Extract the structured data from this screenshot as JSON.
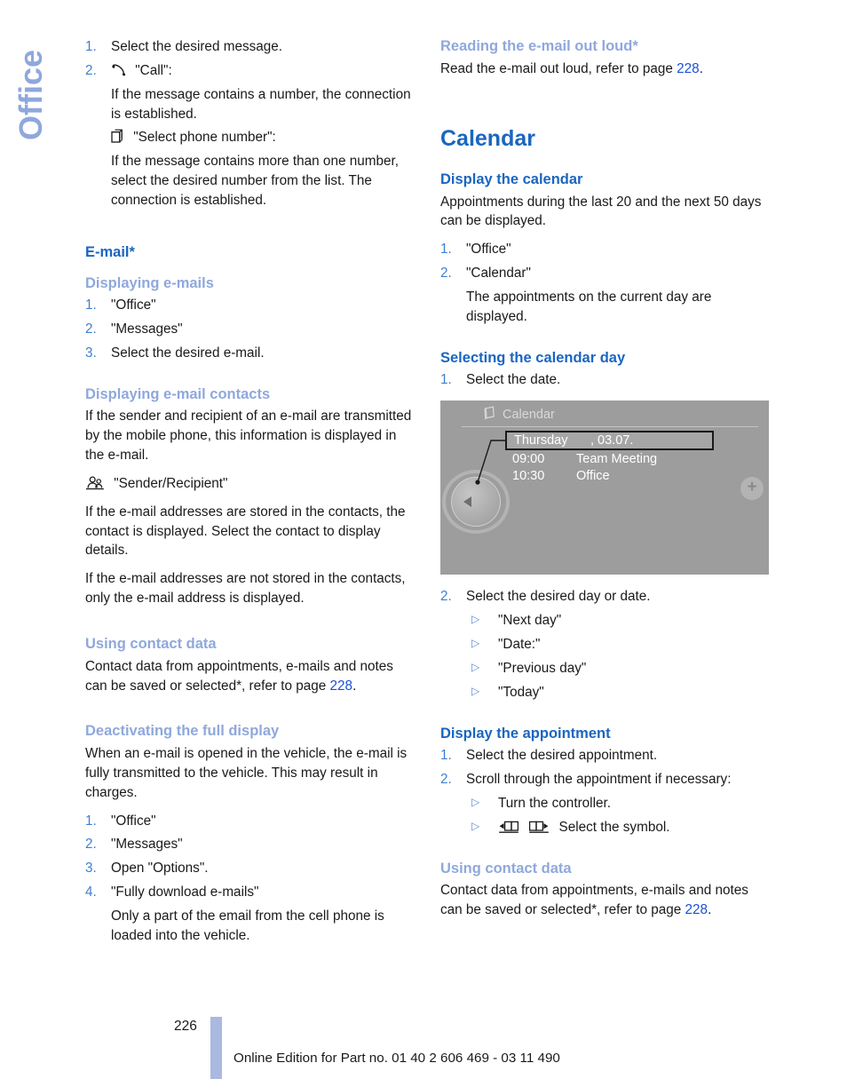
{
  "side_tab": {
    "label": "Office"
  },
  "left_column": {
    "top_steps": [
      {
        "num": "1.",
        "text": "Select the desired message."
      },
      {
        "num": "2.",
        "icon": "phone-handset-icon",
        "text": "\"Call\":"
      }
    ],
    "call_note": "If the message contains a number, the connection is established.",
    "select_number_icon": "stacked-pages-icon",
    "select_number_label": "\"Select phone number\":",
    "select_number_note": "If the message contains more than one number, select the desired number from the list. The connection is established.",
    "email_heading": "E-mail*",
    "displaying_emails_heading": "Displaying e-mails",
    "displaying_emails_steps": [
      {
        "num": "1.",
        "text": "\"Office\""
      },
      {
        "num": "2.",
        "text": "\"Messages\""
      },
      {
        "num": "3.",
        "text": "Select the desired e-mail."
      }
    ],
    "contacts_heading": "Displaying e-mail contacts",
    "contacts_para1": "If the sender and recipient of an e-mail are transmitted by the mobile phone, this information is displayed in the e-mail.",
    "sender_recipient_icon": "contacts-people-icon",
    "sender_recipient_label": "\"Sender/Recipient\"",
    "contacts_para2": "If the e-mail addresses are stored in the contacts, the contact is displayed. Select the contact to display details.",
    "contacts_para3": "If the e-mail addresses are not stored in the contacts, only the e-mail address is displayed.",
    "using_contact_heading": "Using contact data",
    "using_contact_text_pre": "Contact data from appointments, e-mails and notes can be saved or selected*, refer to page ",
    "using_contact_pageref": "228",
    "using_contact_text_post": ".",
    "deactivating_heading": "Deactivating the full display",
    "deactivating_para": "When an e-mail is opened in the vehicle, the e-mail is fully transmitted to the vehicle. This may result in charges.",
    "deactivating_steps": [
      {
        "num": "1.",
        "text": "\"Office\""
      },
      {
        "num": "2.",
        "text": "\"Messages\""
      },
      {
        "num": "3.",
        "text": "Open \"Options\"."
      },
      {
        "num": "4.",
        "text": "\"Fully download e-mails\""
      }
    ],
    "deactivating_step4_note": "Only a part of the email from the cell phone is loaded into the vehicle."
  },
  "right_column": {
    "reading_heading": "Reading the e-mail out loud*",
    "reading_text_pre": "Read the e-mail out loud, refer to page ",
    "reading_pageref": "228",
    "reading_text_post": ".",
    "calendar_heading": "Calendar",
    "display_calendar_heading": "Display the calendar",
    "display_calendar_para": "Appointments during the last 20 and the next 50 days can be displayed.",
    "display_calendar_steps": [
      {
        "num": "1.",
        "text": "\"Office\""
      },
      {
        "num": "2.",
        "text": "\"Calendar\""
      }
    ],
    "display_calendar_step2_note": "The appointments on the current day are displayed.",
    "selecting_day_heading": "Selecting the calendar day",
    "selecting_day_step1": {
      "num": "1.",
      "text": "Select the date."
    },
    "figure": {
      "screen_icon": "calendar-page-icon",
      "screen_title": "Calendar",
      "selected_day": "Thursday",
      "selected_date": ", 03.07.",
      "appointments": [
        {
          "time": "09:00",
          "title": "Team Meeting"
        },
        {
          "time": "10:30",
          "title": "Office"
        }
      ],
      "plus_label": "+",
      "controller_icon": "controller-knob-icon"
    },
    "selecting_day_step2": {
      "num": "2.",
      "text": "Select the desired day or date."
    },
    "selecting_day_options": [
      "\"Next day\"",
      "\"Date:\"",
      "\"Previous day\"",
      "\"Today\""
    ],
    "display_appointment_heading": "Display the appointment",
    "display_appointment_steps": [
      {
        "num": "1.",
        "text": "Select the desired appointment."
      },
      {
        "num": "2.",
        "text": "Scroll through the appointment if necessary:"
      }
    ],
    "display_appointment_subs": [
      {
        "icon": null,
        "text": "Turn the controller."
      },
      {
        "icon": "book-page-back-icon book-page-forward-icon",
        "text": "Select the symbol."
      }
    ],
    "using_contact_heading": "Using contact data",
    "using_contact_text_pre": "Contact data from appointments, e-mails and notes can be saved or selected*, refer to page ",
    "using_contact_pageref": "228",
    "using_contact_text_post": "."
  },
  "footer": {
    "page_number": "226",
    "edition_text": "Online Edition for Part no. 01 40 2 606 469 - 03 11 490"
  },
  "colors": {
    "heading_blue": "#1a66c0",
    "heading_light_blue": "#8fa8dc",
    "list_number_blue": "#3d7fd0",
    "page_ref_blue": "#1a4fd8",
    "footer_bar": "#aab9e0"
  }
}
